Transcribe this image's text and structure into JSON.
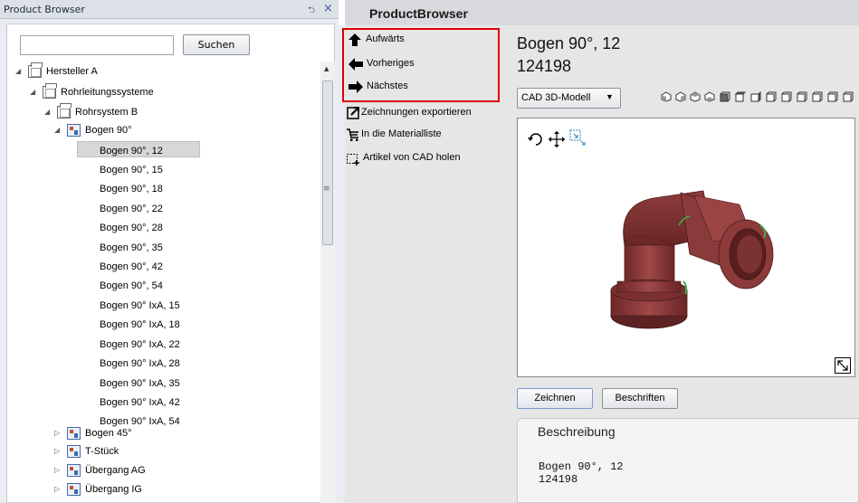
{
  "left_panel": {
    "title": "Product Browser",
    "pin_glyph": "⮌",
    "close_glyph": "×",
    "search": {
      "value": "",
      "placeholder": "",
      "button_label": "Suchen"
    },
    "tree": {
      "manufacturer": "Hersteller A",
      "system_group": "Rohrleitungssysteme",
      "system": "Rohrsystem B",
      "expanded_category": "Bogen 90°",
      "items": [
        "Bogen 90°, 12",
        "Bogen 90°, 15",
        "Bogen 90°, 18",
        "Bogen 90°, 22",
        "Bogen 90°, 28",
        "Bogen 90°, 35",
        "Bogen 90°, 42",
        "Bogen 90°, 54",
        "Bogen 90° IxA, 15",
        "Bogen 90° IxA, 18",
        "Bogen 90° IxA, 22",
        "Bogen 90° IxA, 28",
        "Bogen 90° IxA, 35",
        "Bogen 90° IxA, 42",
        "Bogen 90° IxA, 54"
      ],
      "selected_item": "Bogen 90°, 12",
      "collapsed_categories": [
        "Bogen 45°",
        "T-Stück",
        "Übergang AG",
        "Übergang IG"
      ]
    }
  },
  "right_panel": {
    "title": "ProductBrowser",
    "navigation": {
      "up_label": "Aufwärts",
      "previous_label": "Vorheriges",
      "next_label": "Nächstes",
      "highlight_color": "#e00000"
    },
    "actions": {
      "export_label": "Zeichnungen exportieren",
      "material_list_label": "In die Materialliste",
      "cad_label": "Artikel von CAD holen"
    },
    "product": {
      "title": "Bogen 90°, 12",
      "number": "124198"
    },
    "model_select": {
      "value": "CAD 3D-Modell"
    },
    "buttons": {
      "draw_label": "Zeichnen",
      "label_label": "Beschriften"
    },
    "description": {
      "heading": "Beschreibung",
      "text": "Bogen 90°, 12\n124198"
    },
    "model_color": "#8b3a3a"
  }
}
